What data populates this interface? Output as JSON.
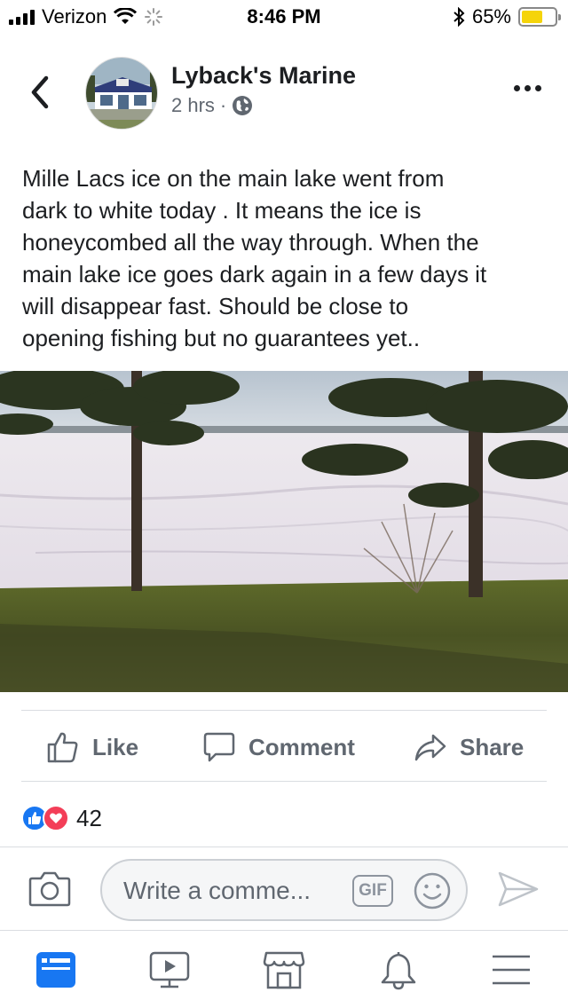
{
  "status_bar": {
    "carrier": "Verizon",
    "time": "8:46 PM",
    "battery_percent": "65%",
    "battery_level": 0.65,
    "icons": [
      "signal-icon",
      "wifi-icon",
      "activity-spinner-icon",
      "bluetooth-icon",
      "battery-icon"
    ]
  },
  "header": {
    "page_name": "Lyback's Marine",
    "timestamp": "2 hrs",
    "separator": "·",
    "privacy_icon": "globe-icon",
    "back_icon": "chevron-left-icon",
    "more_icon": "more-dots-icon"
  },
  "post": {
    "text": "Mille Lacs ice on the main lake went from\ndark to white today . It means the ice is\nhoneycombed all the way through.  When the\nmain lake ice goes dark again in a few days it\nwill disappear fast.  Should be close to\nopening fishing but no guarantees yet.."
  },
  "actions": {
    "like_label": "Like",
    "comment_label": "Comment",
    "share_label": "Share"
  },
  "reactions": {
    "types": [
      "like",
      "love"
    ],
    "count": "42",
    "like_color": "#1877f2",
    "love_color": "#f33e58"
  },
  "comment_composer": {
    "placeholder": "Write a comme...",
    "gif_label": "GIF"
  },
  "bottom_nav": {
    "items": [
      "news-feed-icon",
      "watch-video-icon",
      "marketplace-icon",
      "notifications-bell-icon",
      "menu-icon"
    ],
    "active": "news-feed-icon",
    "accent_color": "#1877f2"
  }
}
